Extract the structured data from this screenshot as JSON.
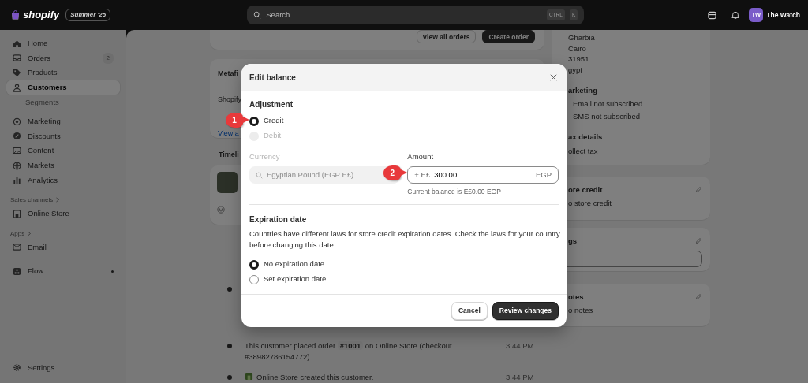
{
  "topbar": {
    "logo_text": "shopify",
    "edition": "Summer '25",
    "search": {
      "placeholder": "Search",
      "keys": [
        "CTRL",
        "K"
      ]
    },
    "avatar": "TW",
    "store_name": "The Watch"
  },
  "sidebar": {
    "groups": [
      {
        "items": [
          {
            "label": "Home",
            "selected": false
          },
          {
            "label": "Orders",
            "badge": "2",
            "selected": false
          },
          {
            "label": "Products",
            "selected": false
          },
          {
            "label": "Customers",
            "selected": true,
            "children": [
              {
                "label": "Segments",
                "selected": false
              }
            ]
          }
        ]
      },
      {
        "items": [
          {
            "label": "Marketing",
            "selected": false
          },
          {
            "label": "Discounts",
            "selected": false
          },
          {
            "label": "Content",
            "selected": false
          },
          {
            "label": "Markets",
            "selected": false
          },
          {
            "label": "Analytics",
            "selected": false
          }
        ]
      },
      {
        "heading": "Sales channels",
        "items": [
          {
            "label": "Online Store",
            "selected": false
          }
        ]
      },
      {
        "heading": "Apps",
        "items": [
          {
            "label": "Email",
            "selected": false
          }
        ]
      },
      {
        "items": [
          {
            "label": "Flow",
            "selected": false,
            "dot": true
          }
        ]
      }
    ],
    "footer_item": "Settings"
  },
  "orders_card": {
    "buttons": [
      {
        "label": "View all orders",
        "kind": "secondary"
      },
      {
        "label": "Create order",
        "kind": "primary"
      }
    ]
  },
  "metafields_card": {
    "title": "Metafi",
    "text": "Shopify",
    "link": "View a"
  },
  "timeline": {
    "title": "Timeli",
    "events": [
      {
        "kind": "covered"
      },
      {
        "kind": "message",
        "text": "This customer placed order **#1001** on Online Store (checkout #38982786154772).",
        "time": "3:44 PM"
      },
      {
        "kind": "store",
        "text": "Online Store created this customer.",
        "time": "3:44 PM"
      }
    ]
  },
  "customer_panel": {
    "address": [
      "Gharbia",
      "Cairo",
      "31951",
      "gypt"
    ],
    "marketing": {
      "heading": "arketing",
      "items": [
        "Email not subscribed",
        "SMS not subscribed"
      ]
    },
    "tax": {
      "heading": "ax details",
      "value": "ollect tax"
    }
  },
  "store_credit": {
    "heading": "ore credit",
    "value": "o store credit"
  },
  "tags": {
    "heading": "gs"
  },
  "notes": {
    "heading": "otes",
    "value": "o notes"
  },
  "modal": {
    "title": "Edit balance",
    "adjustment": {
      "heading": "Adjustment",
      "options": [
        {
          "label": "Credit",
          "selected": true,
          "disabled": false
        },
        {
          "label": "Debit",
          "selected": false,
          "disabled": true
        }
      ]
    },
    "currency": {
      "label": "Currency",
      "value": "Egyptian Pound (EGP E£)",
      "disabled": true
    },
    "amount": {
      "label": "Amount",
      "prefix": "+ E£",
      "value": "300.00",
      "suffix": "EGP",
      "help": "Current balance is E£0.00 EGP"
    },
    "expiration": {
      "heading": "Expiration date",
      "description": "Countries have different laws for store credit expiration dates. Check the laws for your country before changing this date.",
      "options": [
        {
          "label": "No expiration date",
          "selected": true
        },
        {
          "label": "Set expiration date",
          "selected": false
        }
      ]
    },
    "buttons": [
      {
        "label": "Cancel",
        "kind": "secondary"
      },
      {
        "label": "Review changes",
        "kind": "primary"
      }
    ]
  },
  "callouts": [
    {
      "label": "1"
    },
    {
      "label": "2"
    }
  ]
}
